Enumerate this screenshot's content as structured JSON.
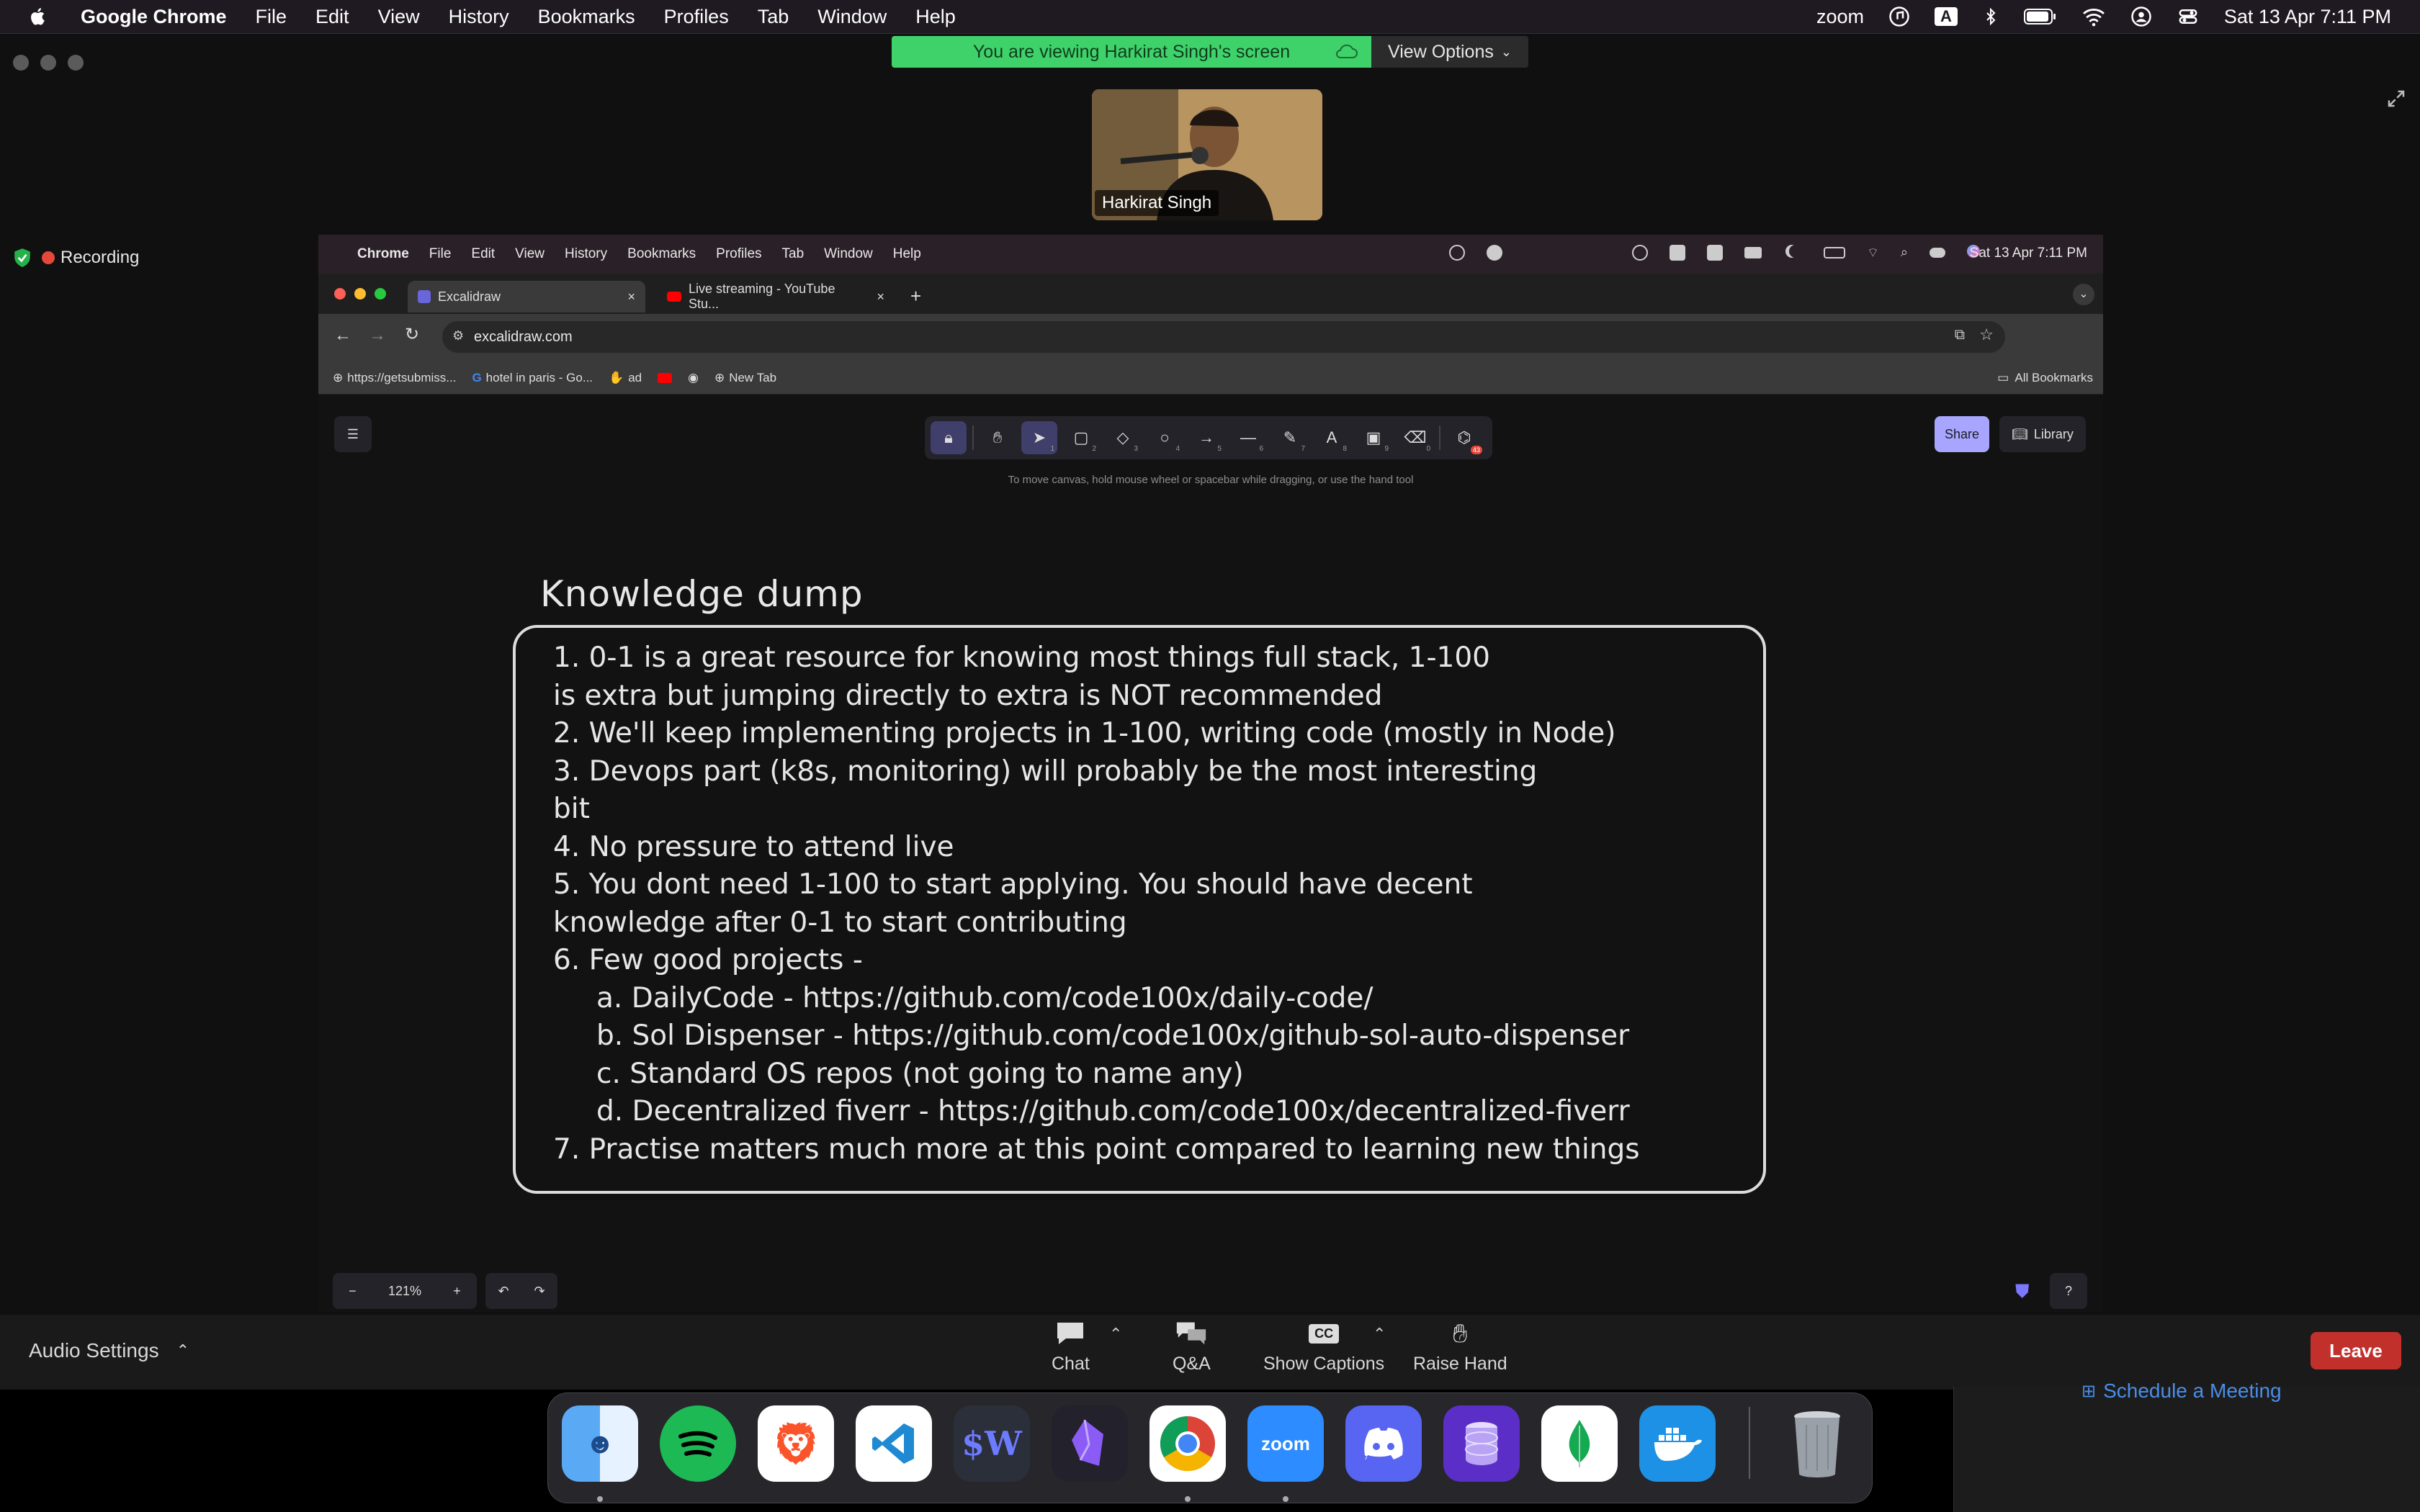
{
  "mac_menubar": {
    "app": "Google Chrome",
    "menus": [
      "File",
      "Edit",
      "View",
      "History",
      "Bookmarks",
      "Profiles",
      "Tab",
      "Window",
      "Help"
    ],
    "zoom_label": "zoom",
    "input_indicator": "A",
    "datetime": "Sat 13 Apr  7:11 PM"
  },
  "zoom": {
    "banner": "You are viewing Harkirat Singh's screen",
    "view_options": "View Options",
    "presenter_name": "Harkirat Singh",
    "recording": "Recording",
    "audio_settings": "Audio Settings",
    "controls": {
      "chat": "Chat",
      "qa": "Q&A",
      "captions": "Show Captions",
      "cc": "CC",
      "raise_hand": "Raise Hand"
    },
    "leave": "Leave",
    "schedule": "Schedule a Meeting"
  },
  "shared_screen": {
    "menubar": {
      "app": "Chrome",
      "menus": [
        "File",
        "Edit",
        "View",
        "History",
        "Bookmarks",
        "Profiles",
        "Tab",
        "Window",
        "Help"
      ],
      "datetime": "Sat 13 Apr  7:11 PM"
    },
    "tabs": [
      {
        "title": "Excalidraw",
        "close": "×"
      },
      {
        "title": "Live streaming - YouTube Stu...",
        "close": "×"
      }
    ],
    "url": "excalidraw.com",
    "bookmarks": [
      "https://getsubmiss...",
      "hotel in paris - Go...",
      "ad",
      "New Tab"
    ],
    "all_bookmarks": "All Bookmarks",
    "excalidraw": {
      "hint": "To move canvas, hold mouse wheel or spacebar while dragging, or use the hand tool",
      "share": "Share",
      "library": "Library",
      "zoom_level": "121%",
      "tool_badge": "43",
      "tool_numbers": [
        "1",
        "2",
        "3",
        "4",
        "5",
        "6",
        "7",
        "8",
        "9",
        "0"
      ],
      "title": "Knowledge dump",
      "lines": [
        "1. 0-1 is a great resource for knowing most things full stack, 1-100",
        "is extra but jumping directly to extra is NOT recommended",
        "2. We'll keep implementing projects in 1-100, writing code (mostly in Node)",
        "3. Devops part (k8s, monitoring) will probably be the most interesting",
        "bit",
        "4. No pressure to attend live",
        "5. You dont need 1-100 to start applying. You should have decent",
        "knowledge after 0-1 to start contributing",
        "6. Few good projects -",
        "a. DailyCode - https://github.com/code100x/daily-code/",
        "b. Sol Dispenser - https://github.com/code100x/github-sol-auto-dispenser",
        "c. Standard OS repos (not going to name any)",
        "d. Decentralized fiverr - https://github.com/code100x/decentralized-fiverr",
        "7. Practise matters much more at this point compared to learning new things"
      ]
    }
  },
  "dock": {
    "apps": [
      "Finder",
      "Spotify",
      "Brave",
      "VS Code",
      "$W",
      "Obsidian",
      "Chrome",
      "zoom",
      "Discord",
      "Database",
      "MongoDB",
      "Docker",
      "Trash"
    ],
    "dollar_w": "$W",
    "zoom_label": "zoom"
  }
}
